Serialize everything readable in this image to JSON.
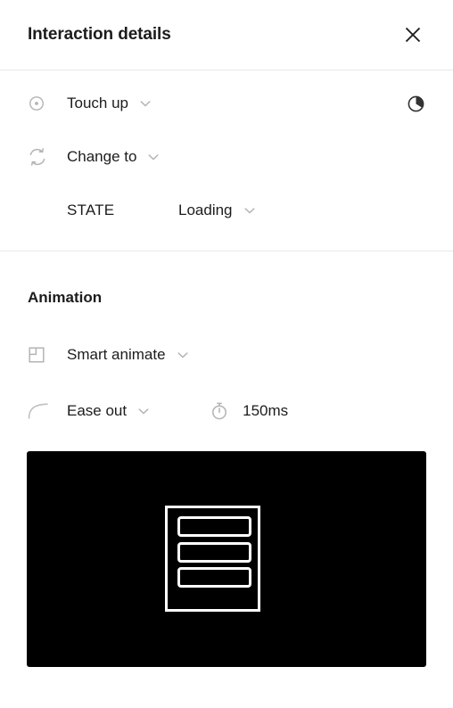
{
  "header": {
    "title": "Interaction details",
    "close_icon": "close-icon"
  },
  "interaction": {
    "trigger": {
      "icon": "tap-circle-icon",
      "label": "Touch up",
      "chevron": "chevron-down-icon"
    },
    "timing_indicator": {
      "icon": "pie-timer-icon"
    },
    "action": {
      "icon": "swap-cycle-icon",
      "label": "Change to",
      "chevron": "chevron-down-icon"
    },
    "destination": {
      "key": "STATE",
      "value": "Loading",
      "chevron": "chevron-down-icon"
    }
  },
  "animation": {
    "heading": "Animation",
    "type": {
      "icon": "smart-animate-icon",
      "label": "Smart animate",
      "chevron": "chevron-down-icon"
    },
    "easing": {
      "icon": "ease-curve-icon",
      "label": "Ease out",
      "chevron": "chevron-down-icon"
    },
    "duration": {
      "icon": "stopwatch-icon",
      "value": "150ms"
    }
  },
  "preview": {
    "name": "animation-preview",
    "background_color": "#000000",
    "stroke_color": "#ffffff",
    "bars": 3
  },
  "colors": {
    "text": "#1c1c1c",
    "icon_gray": "#b4b4b4",
    "divider": "#e8e8e8",
    "accent_dark": "#333333"
  }
}
